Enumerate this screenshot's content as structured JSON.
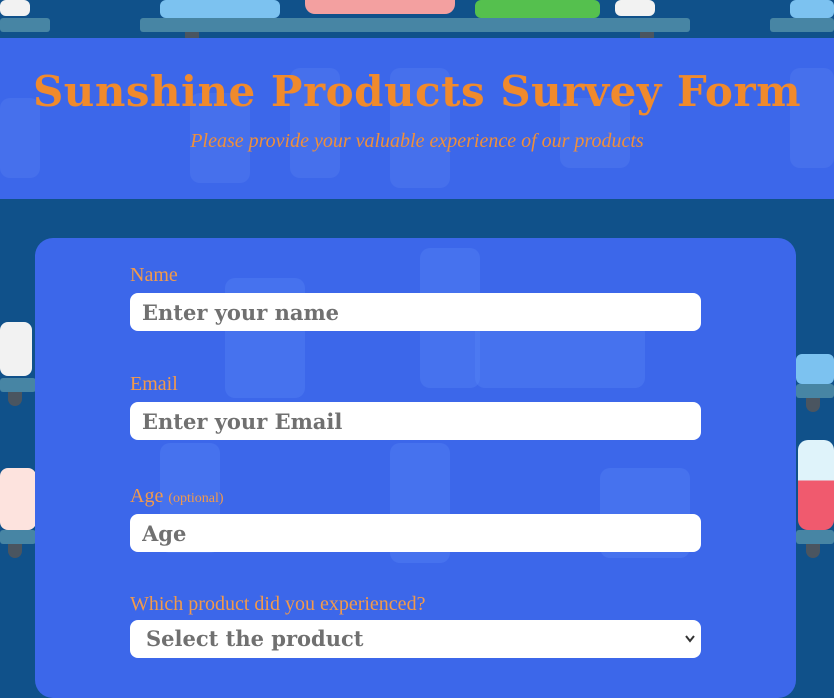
{
  "header": {
    "title": "Sunshine Products Survey Form",
    "subtitle": "Please provide your valuable experience of our products"
  },
  "form": {
    "name": {
      "label": "Name",
      "placeholder": "Enter your name",
      "value": ""
    },
    "email": {
      "label": "Email",
      "placeholder": "Enter your Email",
      "value": ""
    },
    "age": {
      "label": "Age",
      "optional": "(optional)",
      "placeholder": "Age",
      "value": ""
    },
    "product": {
      "label": "Which product did you experienced?",
      "selected": "Select the product",
      "icon": "chevron-down-icon"
    }
  },
  "colors": {
    "page_background": "#10518a",
    "panel_background": "#3c67ea",
    "accent_orange": "#f08a2c",
    "input_background": "#ffffff"
  }
}
